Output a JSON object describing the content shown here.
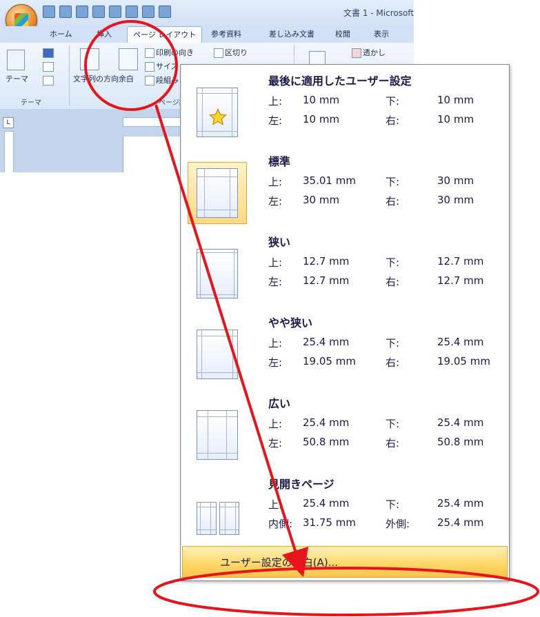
{
  "window": {
    "title": "文書 1 - Microsoft"
  },
  "ribbon": {
    "tabs": [
      {
        "label": "ホーム"
      },
      {
        "label": "挿入"
      },
      {
        "label": "ページ レイアウト"
      },
      {
        "label": "参考資料"
      },
      {
        "label": "差し込み文書"
      },
      {
        "label": "校閲"
      },
      {
        "label": "表示"
      }
    ],
    "active_tab": "ページ レイアウト",
    "theme_button": "テーマ",
    "theme_group_label": "テーマ",
    "text_direction_button": "文字列の方向",
    "margins_button": "余白",
    "orientation_button": "印刷の向き",
    "breaks_button": "区切り",
    "size_button": "サイズ",
    "columns_button": "段組み",
    "page_setup_group_label": "ページ設定",
    "watermark_button": "透かし"
  },
  "margins_menu": {
    "presets": [
      {
        "name": "最後に適用したユーザー設定",
        "row1": {
          "label1": "上:",
          "value1": "10 mm",
          "label2": "下:",
          "value2": "10 mm"
        },
        "row2": {
          "label1": "左:",
          "value1": "10 mm",
          "label2": "右:",
          "value2": "10 mm"
        },
        "icon": "star-icon",
        "selected": false
      },
      {
        "name": "標準",
        "row1": {
          "label1": "上:",
          "value1": "35.01 mm",
          "label2": "下:",
          "value2": "30 mm"
        },
        "row2": {
          "label1": "左:",
          "value1": "30 mm",
          "label2": "右:",
          "value2": "30 mm"
        },
        "selected": true
      },
      {
        "name": "狭い",
        "row1": {
          "label1": "上:",
          "value1": "12.7 mm",
          "label2": "下:",
          "value2": "12.7 mm"
        },
        "row2": {
          "label1": "左:",
          "value1": "12.7 mm",
          "label2": "右:",
          "value2": "12.7 mm"
        },
        "selected": false
      },
      {
        "name": "やや狭い",
        "row1": {
          "label1": "上:",
          "value1": "25.4 mm",
          "label2": "下:",
          "value2": "25.4 mm"
        },
        "row2": {
          "label1": "左:",
          "value1": "19.05 mm",
          "label2": "右:",
          "value2": "19.05 mm"
        },
        "selected": false
      },
      {
        "name": "広い",
        "row1": {
          "label1": "上:",
          "value1": "25.4 mm",
          "label2": "下:",
          "value2": "25.4 mm"
        },
        "row2": {
          "label1": "左:",
          "value1": "50.8 mm",
          "label2": "右:",
          "value2": "50.8 mm"
        },
        "selected": false
      },
      {
        "name": "見開きページ",
        "row1": {
          "label1": "上:",
          "value1": "25.4 mm",
          "label2": "下:",
          "value2": "25.4 mm"
        },
        "row2": {
          "label1": "内側:",
          "value1": "31.75 mm",
          "label2": "外側:",
          "value2": "25.4 mm"
        },
        "selected": false
      }
    ],
    "custom_margins": "ユーザー設定の余白(A)..."
  },
  "colors": {
    "annotation": "#e8141c",
    "highlight": "#ffd96b",
    "highlight_border": "#e0a538",
    "ribbon_blue": "#d2e1f5"
  }
}
